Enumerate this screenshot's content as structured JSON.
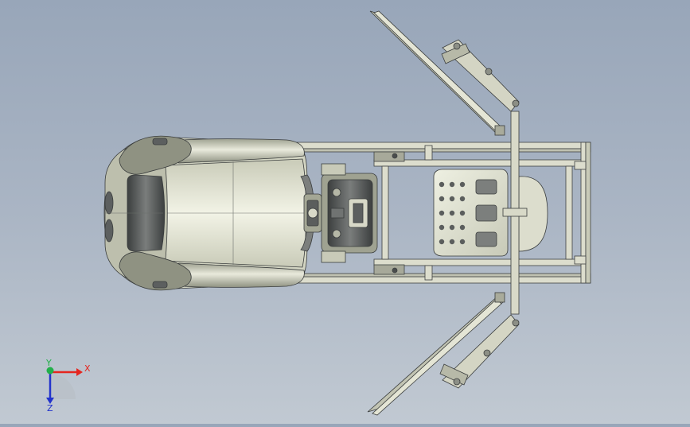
{
  "viewport": {
    "view": "top",
    "background_top": "#98a6b9",
    "background_bottom": "#c1c9d2"
  },
  "model": {
    "parts": [
      "seat",
      "steering-wheel",
      "gear-shifter",
      "pedal-plate",
      "base-frame",
      "left-monitor-arm",
      "right-monitor-arm",
      "left-monitor",
      "right-monitor"
    ],
    "body_color": "#e4e5d5",
    "shadow_color": "#4a4d4d",
    "frame_color": "#d8d9c8"
  },
  "triad": {
    "x_label": "X",
    "y_label": "Y",
    "z_label": "Z",
    "x_color": "#e52620",
    "y_color": "#23b04a",
    "z_color": "#2233cc"
  }
}
